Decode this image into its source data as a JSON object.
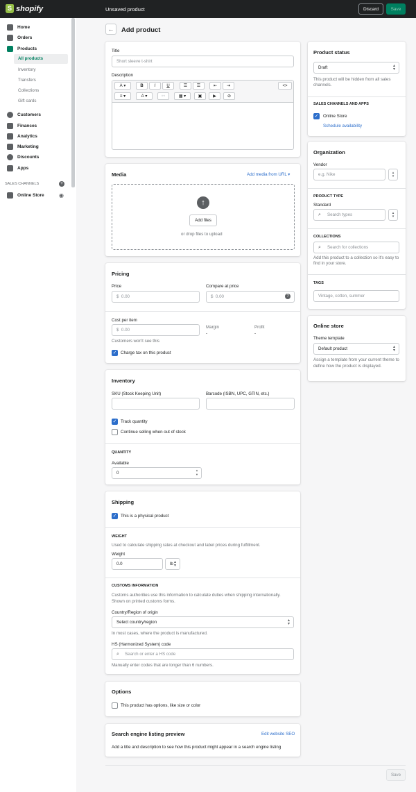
{
  "topbar": {
    "logo": "shopify",
    "title": "Unsaved product",
    "discard": "Discard",
    "save": "Save"
  },
  "sidebar": {
    "items": [
      {
        "label": "Home",
        "icon": "home-icon"
      },
      {
        "label": "Orders",
        "icon": "orders-icon"
      },
      {
        "label": "Products",
        "icon": "tag-icon"
      },
      {
        "label": "Customers",
        "icon": "person-icon"
      },
      {
        "label": "Finances",
        "icon": "bank-icon"
      },
      {
        "label": "Analytics",
        "icon": "bar-chart-icon"
      },
      {
        "label": "Marketing",
        "icon": "megaphone-icon"
      },
      {
        "label": "Discounts",
        "icon": "discount-icon"
      },
      {
        "label": "Apps",
        "icon": "apps-icon"
      }
    ],
    "product_sub": [
      "All products",
      "Inventory",
      "Transfers",
      "Collections",
      "Gift cards"
    ],
    "sales_channels_head": "SALES CHANNELS",
    "online_store": "Online Store"
  },
  "page": {
    "title": "Add product"
  },
  "main": {
    "title_label": "Title",
    "title_placeholder": "Short sleeve t-shirt",
    "description_label": "Description",
    "toolbar": {
      "font": "A",
      "bold": "B",
      "italic": "I",
      "underline": "U",
      "code": "<>"
    },
    "media": {
      "title": "Media",
      "add_url": "Add media from URL",
      "add_files": "Add files",
      "drop": "or drop files to upload"
    },
    "pricing": {
      "title": "Pricing",
      "price": "Price",
      "compare": "Compare at price",
      "currency": "$",
      "placeholder": "0.00",
      "cost": "Cost per item",
      "margin": "Margin",
      "profit": "Profit",
      "dash": "-",
      "cost_note": "Customers won't see this",
      "charge_tax": "Charge tax on this product"
    },
    "inventory": {
      "title": "Inventory",
      "sku": "SKU (Stock Keeping Unit)",
      "barcode": "Barcode (ISBN, UPC, GTIN, etc.)",
      "track": "Track quantity",
      "continue": "Continue selling when out of stock",
      "quantity_head": "QUANTITY",
      "available": "Available",
      "available_value": "0"
    },
    "shipping": {
      "title": "Shipping",
      "physical": "This is a physical product",
      "weight_head": "WEIGHT",
      "weight_note": "Used to calculate shipping rates at checkout and label prices during fulfillment.",
      "weight_label": "Weight",
      "weight_value": "0.0",
      "unit": "lb",
      "customs_head": "CUSTOMS INFORMATION",
      "customs_note": "Customs authorities use this information to calculate duties when shipping internationally. Shown on printed customs forms.",
      "country_label": "Country/Region of origin",
      "country_value": "Select country/region",
      "country_note": "In most cases, where the product is manufactured.",
      "hs_label": "HS (Harmonized System) code",
      "hs_placeholder": "Search or enter a HS code",
      "hs_note": "Manually enter codes that are longer than 6 numbers."
    },
    "options": {
      "title": "Options",
      "has_options": "This product has options, like size or color"
    },
    "seo": {
      "title": "Search engine listing preview",
      "edit": "Edit website SEO",
      "note": "Add a title and description to see how this product might appear in a search engine listing"
    },
    "bottom_save": "Save"
  },
  "right": {
    "status": {
      "title": "Product status",
      "value": "Draft",
      "note": "This product will be hidden from all sales channels.",
      "channels_head": "SALES CHANNELS AND APPS",
      "online_store": "Online Store",
      "schedule": "Schedule availability"
    },
    "organization": {
      "title": "Organization",
      "vendor": "Vendor",
      "vendor_placeholder": "e.g. Nike",
      "type_head": "PRODUCT TYPE",
      "type_value": "Standard",
      "type_placeholder": "Search types",
      "collections_head": "COLLECTIONS",
      "collections_placeholder": "Search for collections",
      "collections_note": "Add this product to a collection so it's easy to find in your store.",
      "tags_head": "TAGS",
      "tags_placeholder": "Vintage, cotton, summer"
    },
    "online_store": {
      "title": "Online store",
      "theme_label": "Theme template",
      "theme_value": "Default product",
      "theme_note": "Assign a template from your current theme to define how the product is displayed."
    }
  }
}
